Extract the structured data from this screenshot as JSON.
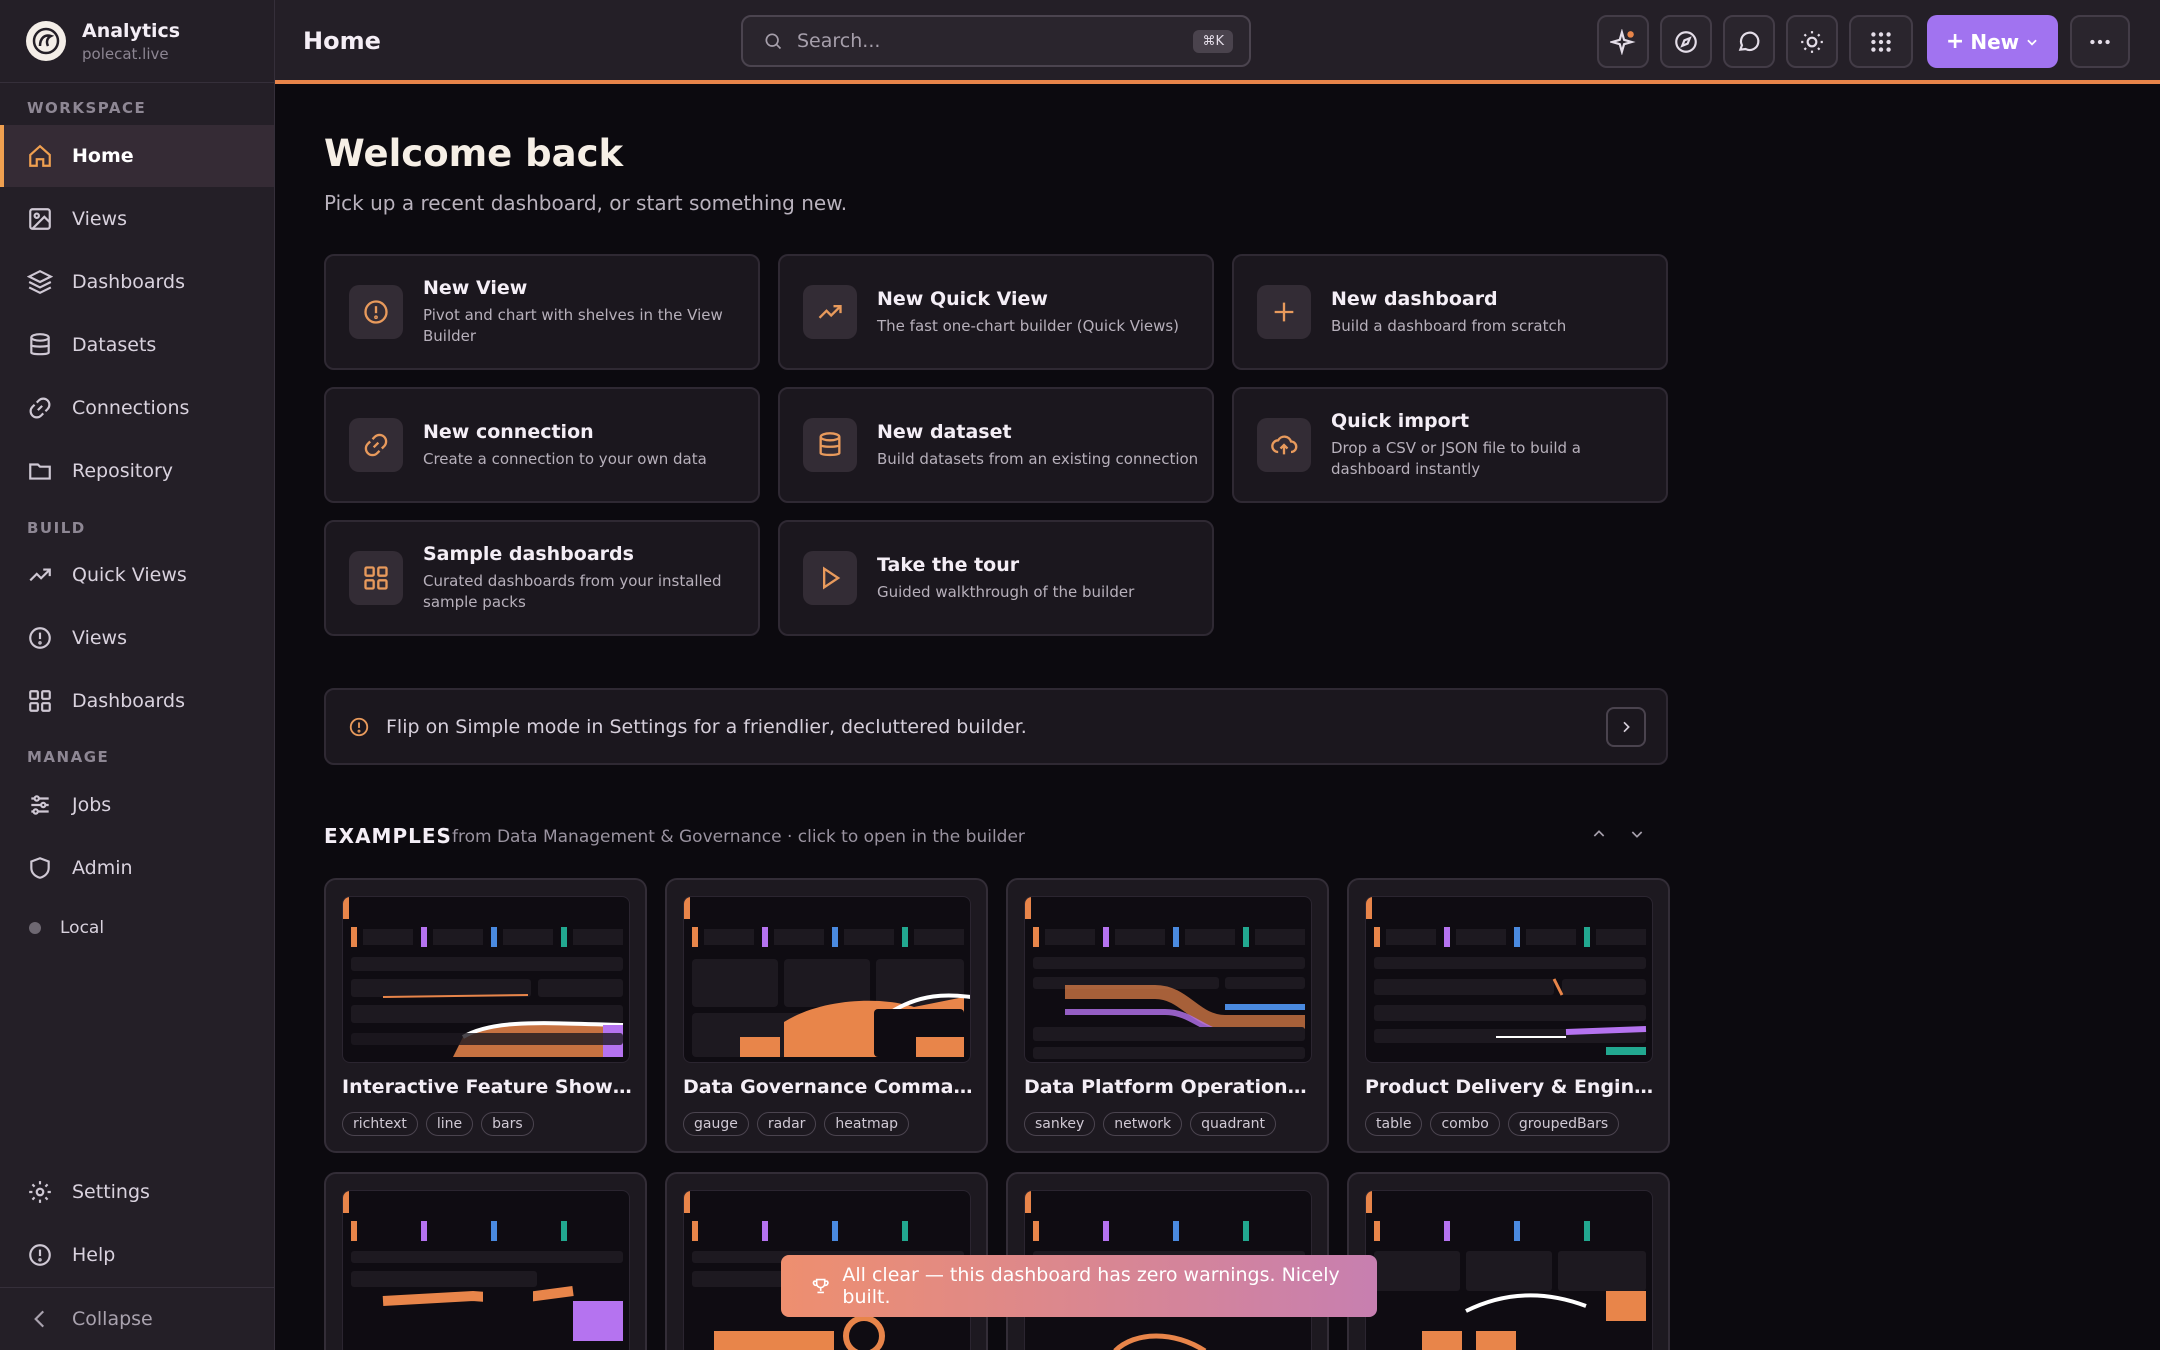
{
  "app": {
    "title": "Analytics",
    "domain": "polecat.live"
  },
  "sidebar": {
    "sections": {
      "workspace": "WORKSPACE",
      "build": "BUILD",
      "manage": "MANAGE"
    },
    "items": [
      {
        "label": "Home",
        "icon": "home-icon"
      },
      {
        "label": "Views",
        "icon": "image-icon"
      },
      {
        "label": "Dashboards",
        "icon": "layers-icon"
      },
      {
        "label": "Datasets",
        "icon": "database-icon"
      },
      {
        "label": "Connections",
        "icon": "link-icon"
      },
      {
        "label": "Repository",
        "icon": "folder-icon"
      },
      {
        "label": "Quick Views",
        "icon": "trend-icon"
      },
      {
        "label": "Views",
        "icon": "alert-circle-icon"
      },
      {
        "label": "Dashboards",
        "icon": "grid-icon"
      },
      {
        "label": "Jobs",
        "icon": "sliders-icon"
      },
      {
        "label": "Admin",
        "icon": "shield-icon"
      },
      {
        "label": "Local",
        "icon": "dot-icon"
      },
      {
        "label": "Settings",
        "icon": "gear-icon"
      },
      {
        "label": "Help",
        "icon": "alert-circle-icon"
      },
      {
        "label": "Collapse",
        "icon": "chevron-left-icon"
      }
    ]
  },
  "header": {
    "title": "Home",
    "search_placeholder": "Search...",
    "search_shortcut": "⌘K",
    "new_label": "New"
  },
  "main": {
    "welcome": "Welcome back",
    "subtitle": "Pick up a recent dashboard, or start something new.",
    "cards": [
      {
        "title": "New View",
        "desc": "Pivot and chart with shelves in the View Builder"
      },
      {
        "title": "New Quick View",
        "desc": "The fast one-chart builder (Quick Views)"
      },
      {
        "title": "New dashboard",
        "desc": "Build a dashboard from scratch"
      },
      {
        "title": "New connection",
        "desc": "Create a connection to your own data"
      },
      {
        "title": "New dataset",
        "desc": "Build datasets from an existing connection"
      },
      {
        "title": "Quick import",
        "desc": "Drop a CSV or JSON file to build a dashboard instantly"
      },
      {
        "title": "Sample dashboards",
        "desc": "Curated dashboards from your installed sample packs"
      },
      {
        "title": "Take the tour",
        "desc": "Guided walkthrough of the builder"
      }
    ],
    "tip": "Flip on Simple mode in Settings for a friendlier, decluttered builder.",
    "examples_title": "EXAMPLES",
    "examples_sub": "from Data Management & Governance · click to open in the builder",
    "examples": [
      {
        "title": "Interactive Feature Showcase",
        "tags": [
          "richtext",
          "line",
          "bars"
        ]
      },
      {
        "title": "Data Governance Command C...",
        "tags": [
          "gauge",
          "radar",
          "heatmap"
        ]
      },
      {
        "title": "Data Platform Operations Cent...",
        "tags": [
          "sankey",
          "network",
          "quadrant"
        ]
      },
      {
        "title": "Product Delivery & Engineering...",
        "tags": [
          "table",
          "combo",
          "groupedBars"
        ]
      }
    ],
    "toast": "All clear — this dashboard has zero warnings. Nicely built."
  },
  "colors": {
    "accent": "#e8854a",
    "primary": "#a173f0",
    "icon": "#e89a5c"
  }
}
